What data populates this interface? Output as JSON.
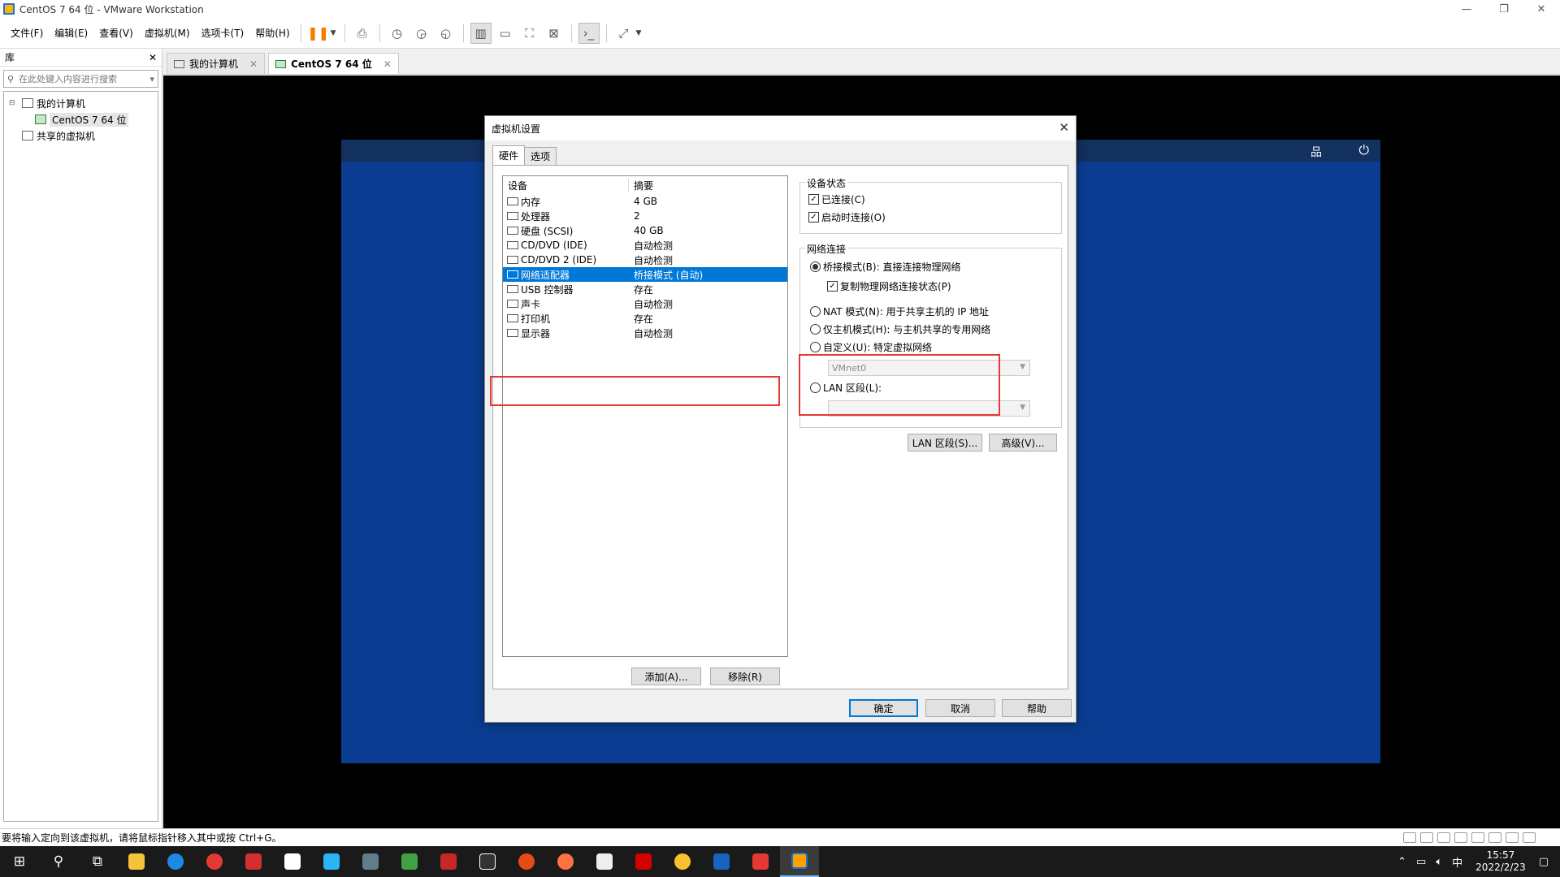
{
  "window": {
    "title": "CentOS 7 64 位 - VMware Workstation",
    "minimize": "—",
    "restore": "❐",
    "close": "✕"
  },
  "menu": [
    "文件(F)",
    "编辑(E)",
    "查看(V)",
    "虚拟机(M)",
    "选项卡(T)",
    "帮助(H)"
  ],
  "library": {
    "title": "库",
    "close": "✕",
    "search_placeholder": "在此处键入内容进行搜索",
    "tree": {
      "my_computer": "我的计算机",
      "vm": "CentOS 7 64 位",
      "shared": "共享的虚拟机"
    }
  },
  "tabs": [
    {
      "label": "我的计算机",
      "close": "✕"
    },
    {
      "label": "CentOS 7 64 位",
      "close": "✕"
    }
  ],
  "dialog": {
    "title": "虚拟机设置",
    "close": "✕",
    "tabs": [
      "硬件",
      "选项"
    ],
    "device_header": {
      "device": "设备",
      "summary": "摘要"
    },
    "devices": [
      {
        "name": "内存",
        "summary": "4 GB",
        "icon": "memory-icon"
      },
      {
        "name": "处理器",
        "summary": "2",
        "icon": "cpu-icon"
      },
      {
        "name": "硬盘 (SCSI)",
        "summary": "40 GB",
        "icon": "harddisk-icon"
      },
      {
        "name": "CD/DVD (IDE)",
        "summary": "自动检测",
        "icon": "cd-icon"
      },
      {
        "name": "CD/DVD 2 (IDE)",
        "summary": "自动检测",
        "icon": "cd-icon"
      },
      {
        "name": "网络适配器",
        "summary": "桥接模式 (自动)",
        "icon": "network-icon"
      },
      {
        "name": "USB 控制器",
        "summary": "存在",
        "icon": "usb-icon"
      },
      {
        "name": "声卡",
        "summary": "自动检测",
        "icon": "sound-icon"
      },
      {
        "name": "打印机",
        "summary": "存在",
        "icon": "printer-icon"
      },
      {
        "name": "显示器",
        "summary": "自动检测",
        "icon": "display-icon"
      }
    ],
    "selected_device_index": 5,
    "add_button": "添加(A)...",
    "remove_button": "移除(R)",
    "device_status": {
      "label": "设备状态",
      "connected": "已连接(C)",
      "connect_at_power_on": "启动时连接(O)"
    },
    "network": {
      "label": "网络连接",
      "bridged": "桥接模式(B): 直接连接物理网络",
      "replicate": "复制物理网络连接状态(P)",
      "nat": "NAT 模式(N): 用于共享主机的 IP 地址",
      "host_only": "仅主机模式(H): 与主机共享的专用网络",
      "custom": "自定义(U): 特定虚拟网络",
      "custom_value": "VMnet0",
      "lan_segment": "LAN 区段(L):",
      "lan_value": ""
    },
    "lan_segments_button": "LAN 区段(S)...",
    "advanced_button": "高级(V)...",
    "ok_button": "确定",
    "cancel_button": "取消",
    "help_button": "帮助"
  },
  "status_text": "要将输入定向到该虚拟机，请将鼠标指针移入其中或按 Ctrl+G。",
  "taskbar": {
    "time": "15:57",
    "date": "2022/2/23",
    "ime": "中"
  },
  "colors": {
    "vm_background": "#0a3d91",
    "selection": "#0078d7",
    "highlight_box": "#e53935"
  }
}
